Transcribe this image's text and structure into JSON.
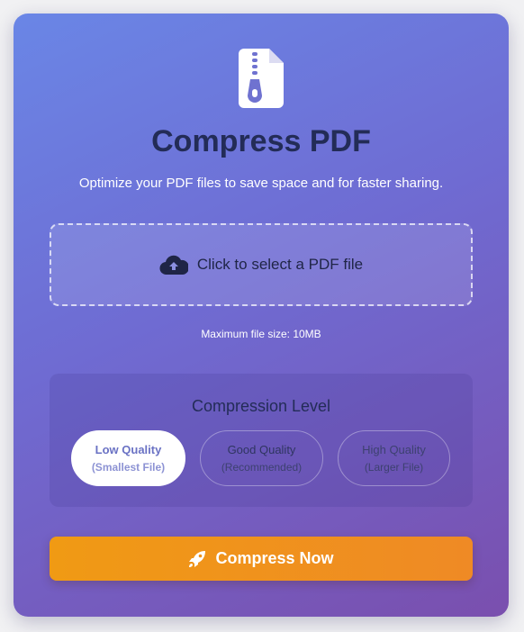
{
  "header": {
    "title": "Compress PDF",
    "subtitle": "Optimize your PDF files to save space and for faster sharing.",
    "logo_icon": "zip-file-icon"
  },
  "upload": {
    "label": "Click to select a PDF file",
    "icon": "cloud-upload-icon",
    "max_size_note": "Maximum file size: 10MB"
  },
  "compression": {
    "title": "Compression Level",
    "options": [
      {
        "label": "Low Quality",
        "sublabel": "(Smallest File)",
        "selected": true
      },
      {
        "label": "Good Quality",
        "sublabel": "(Recommended)",
        "selected": false
      },
      {
        "label": "High Quality",
        "sublabel": "(Larger File)",
        "selected": false
      }
    ]
  },
  "action": {
    "label": "Compress Now",
    "icon": "rocket-icon"
  },
  "colors": {
    "accent_orange": "#f0931a",
    "title_navy": "#232c57",
    "gradient_start": "#6a86e6",
    "gradient_end": "#7a4fae"
  }
}
